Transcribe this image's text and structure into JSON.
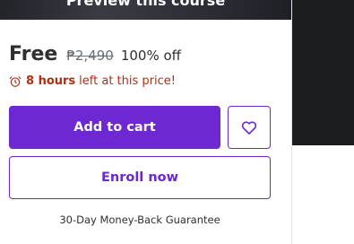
{
  "preview": {
    "label": "Preview this course"
  },
  "pricing": {
    "current": "Free",
    "original": "₱2,490",
    "discount": "100% off"
  },
  "timer": {
    "icon": "alarm-clock-icon",
    "hours": "8 hours",
    "suffix": "left at this price!"
  },
  "actions": {
    "add_to_cart": "Add to cart",
    "wishlist_icon": "heart-icon",
    "enroll": "Enroll now"
  },
  "guarantee": "30-Day Money-Back Guarantee",
  "colors": {
    "accent": "#6d28d2",
    "urgency": "#b32d0f",
    "dark_background": "#1c1d1f",
    "text": "#2d2f31",
    "muted_text": "#6a6f73"
  }
}
